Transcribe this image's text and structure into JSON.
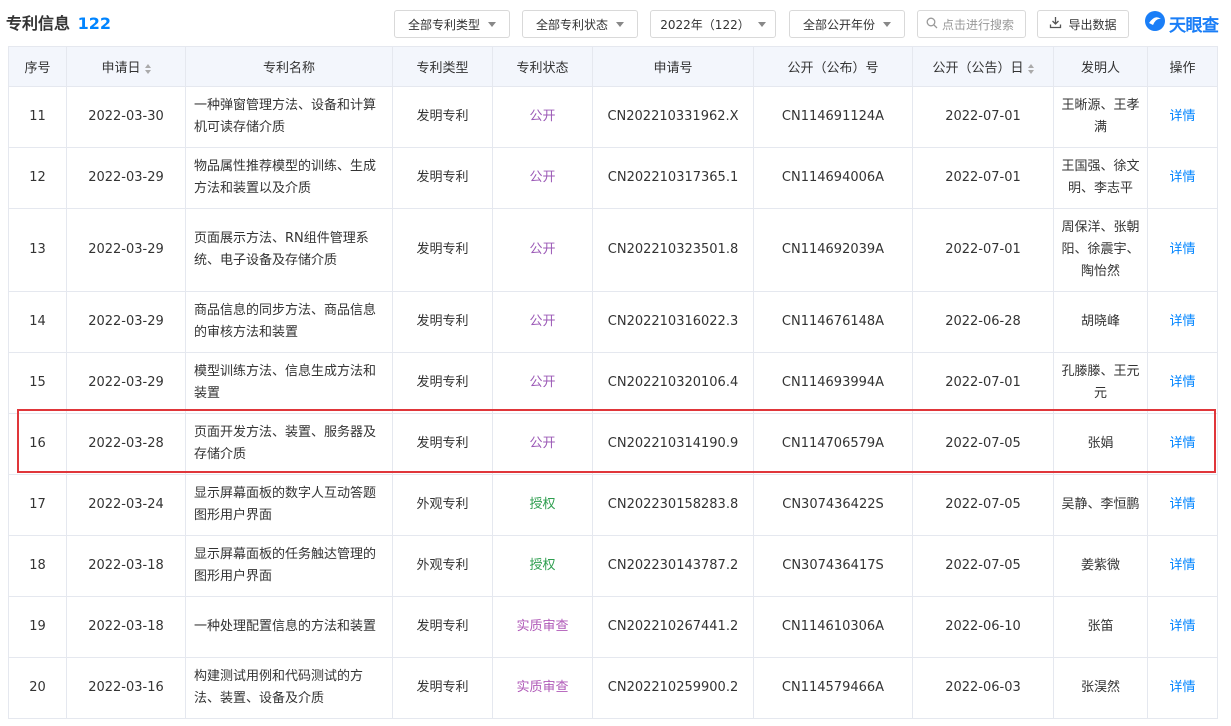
{
  "header": {
    "title": "专利信息",
    "count": "122"
  },
  "filters": {
    "type_label": "全部专利类型",
    "status_label": "全部专利状态",
    "year_label": "2022年（122）",
    "pub_year_label": "全部公开年份"
  },
  "search": {
    "placeholder": "点击进行搜索"
  },
  "export": {
    "label": "导出数据"
  },
  "logo": {
    "text": "天眼查"
  },
  "table": {
    "columns": [
      "序号",
      "申请日",
      "专利名称",
      "专利类型",
      "专利状态",
      "申请号",
      "公开（公布）号",
      "公开（公告）日",
      "发明人",
      "操作"
    ],
    "rows": [
      {
        "no": "11",
        "date": "2022-03-30",
        "name": "一种弹窗管理方法、设备和计算机可读存储介质",
        "type": "发明专利",
        "status": "公开",
        "app_no": "CN202210331962.X",
        "pub_no": "CN114691124A",
        "pub_date": "2022-07-01",
        "inventor": "王晰源、王孝满",
        "action": "详情"
      },
      {
        "no": "12",
        "date": "2022-03-29",
        "name": "物品属性推荐模型的训练、生成方法和装置以及介质",
        "type": "发明专利",
        "status": "公开",
        "app_no": "CN202210317365.1",
        "pub_no": "CN114694006A",
        "pub_date": "2022-07-01",
        "inventor": "王国强、徐文明、李志平",
        "action": "详情"
      },
      {
        "no": "13",
        "date": "2022-03-29",
        "name": "页面展示方法、RN组件管理系统、电子设备及存储介质",
        "type": "发明专利",
        "status": "公开",
        "app_no": "CN202210323501.8",
        "pub_no": "CN114692039A",
        "pub_date": "2022-07-01",
        "inventor": "周保洋、张朝阳、徐震宇、陶怡然",
        "action": "详情"
      },
      {
        "no": "14",
        "date": "2022-03-29",
        "name": "商品信息的同步方法、商品信息的审核方法和装置",
        "type": "发明专利",
        "status": "公开",
        "app_no": "CN202210316022.3",
        "pub_no": "CN114676148A",
        "pub_date": "2022-06-28",
        "inventor": "胡晓峰",
        "action": "详情"
      },
      {
        "no": "15",
        "date": "2022-03-29",
        "name": "模型训练方法、信息生成方法和装置",
        "type": "发明专利",
        "status": "公开",
        "app_no": "CN202210320106.4",
        "pub_no": "CN114693994A",
        "pub_date": "2022-07-01",
        "inventor": "孔滕滕、王元元",
        "action": "详情"
      },
      {
        "no": "16",
        "date": "2022-03-28",
        "name": "页面开发方法、装置、服务器及存储介质",
        "type": "发明专利",
        "status": "公开",
        "app_no": "CN202210314190.9",
        "pub_no": "CN114706579A",
        "pub_date": "2022-07-05",
        "inventor": "张娟",
        "action": "详情"
      },
      {
        "no": "17",
        "date": "2022-03-24",
        "name": "显示屏幕面板的数字人互动答题图形用户界面",
        "type": "外观专利",
        "status": "授权",
        "app_no": "CN202230158283.8",
        "pub_no": "CN307436422S",
        "pub_date": "2022-07-05",
        "inventor": "吴静、李恒鹏",
        "action": "详情"
      },
      {
        "no": "18",
        "date": "2022-03-18",
        "name": "显示屏幕面板的任务触达管理的图形用户界面",
        "type": "外观专利",
        "status": "授权",
        "app_no": "CN202230143787.2",
        "pub_no": "CN307436417S",
        "pub_date": "2022-07-05",
        "inventor": "姜紫微",
        "action": "详情"
      },
      {
        "no": "19",
        "date": "2022-03-18",
        "name": "一种处理配置信息的方法和装置",
        "type": "发明专利",
        "status": "实质审查",
        "app_no": "CN202210267441.2",
        "pub_no": "CN114610306A",
        "pub_date": "2022-06-10",
        "inventor": "张笛",
        "action": "详情"
      },
      {
        "no": "20",
        "date": "2022-03-16",
        "name": "构建测试用例和代码测试的方法、装置、设备及介质",
        "type": "发明专利",
        "status": "实质审查",
        "app_no": "CN202210259900.2",
        "pub_no": "CN114579466A",
        "pub_date": "2022-06-03",
        "inventor": "张淏然",
        "action": "详情"
      }
    ]
  },
  "colors": {
    "accent": "#0084ff",
    "status_open": "#9b59b6",
    "status_grant": "#2e9e4f",
    "highlight": "#e0363a"
  }
}
